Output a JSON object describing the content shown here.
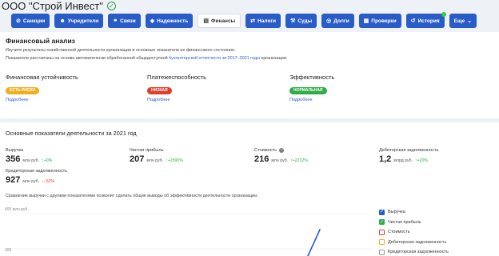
{
  "company": {
    "title": "ООО \"Строй Инвест\"",
    "verified_icon": "check-circle-icon"
  },
  "tabs": [
    {
      "label": "Санкции",
      "icon": "alert-icon"
    },
    {
      "label": "Учредители",
      "icon": "users-icon"
    },
    {
      "label": "Связи",
      "icon": "links-icon"
    },
    {
      "label": "Надежность",
      "icon": "shield-icon"
    },
    {
      "label": "Финансы",
      "icon": "chart-icon",
      "active": true
    },
    {
      "label": "Налоги",
      "icon": "tax-icon"
    },
    {
      "label": "Суды",
      "icon": "gavel-icon"
    },
    {
      "label": "Долги",
      "icon": "debt-icon"
    },
    {
      "label": "Проверки",
      "icon": "clipboard-icon"
    },
    {
      "label": "История",
      "icon": "history-icon"
    },
    {
      "label": "Еще",
      "icon": "chevron-down-icon"
    }
  ],
  "financial_analysis": {
    "heading": "Финансовый анализ",
    "desc1": "Изучите результаты хозяйственной деятельности организации и основные показатели ее финансового состояния.",
    "desc2_before": "Показатели рассчитаны на основе автоматически обработанной общедоступной ",
    "desc2_link": "бухгалтерской отчетности за 2017–2021 годы",
    "desc2_after": " организации.",
    "metrics": [
      {
        "title": "Финансовая устойчивость",
        "badge": "ЕСТЬ РИСКИ",
        "badge_color": "#f0ae1e",
        "more": "Подробнее"
      },
      {
        "title": "Платежеспособность",
        "badge": "НИЗКАЯ",
        "badge_color": "#e23c2a",
        "more": "Подробнее"
      },
      {
        "title": "Эффективность",
        "badge": "НОРМАЛЬНАЯ",
        "badge_color": "#2eac48",
        "more": "Подробнее"
      }
    ]
  },
  "main_indicators": {
    "heading": "Основные показатели деятельности за 2021 год",
    "stats": [
      {
        "label": "Выручка",
        "value": "356",
        "unit": "млн руб.",
        "change": "↑+0%",
        "dir": "up"
      },
      {
        "label": "Чистая прибыль",
        "value": "207",
        "unit": "млн руб.",
        "change": "↑+2590%",
        "dir": "up"
      },
      {
        "label": "Стоимость",
        "value": "216",
        "unit": "млн руб.",
        "change": "↑+2212%",
        "dir": "up"
      },
      {
        "label": "Дебиторская задолженность",
        "value": "1,2",
        "unit": "млрд руб.",
        "change": "↑+20%",
        "dir": "up"
      },
      {
        "label": "Кредиторская задолженность",
        "value": "927",
        "unit": "млн руб.",
        "change": "↓−52%",
        "dir": "down"
      }
    ],
    "compare_text": "Сравнение выручки с другими показателями позволит сделать общие выводы об эффективности деятельности организации."
  },
  "chart_data": {
    "type": "line",
    "ytick_labels": [
      "400 млн руб.",
      "300"
    ],
    "series": [
      {
        "name": "Выручка",
        "color": "#2a5cc8",
        "checked": true
      },
      {
        "name": "Чистая прибыль",
        "color": "#2eac48",
        "checked": true
      },
      {
        "name": "Стоимость",
        "color": "#e23c2a",
        "checked": false
      },
      {
        "name": "Дебиторская задолженность",
        "color": "#f0ae1e",
        "checked": false
      },
      {
        "name": "Кредиторская задолженность",
        "color": "#999999",
        "checked": false
      }
    ]
  }
}
